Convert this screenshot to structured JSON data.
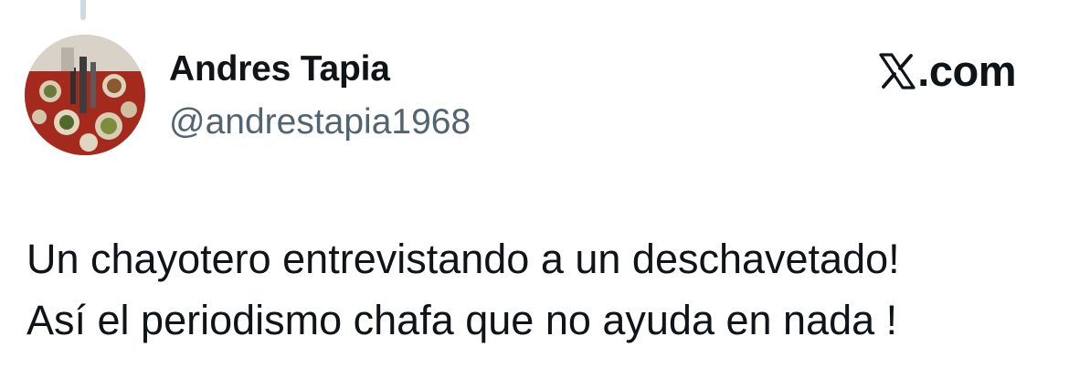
{
  "author": {
    "display_name": "Andres Tapia",
    "handle": "@andrestapia1968",
    "avatar_icon": "profile-photo-table-food"
  },
  "brand": {
    "icon": "x-logo-icon",
    "domain_text": ".com"
  },
  "tweet": {
    "lines": [
      "Un chayotero entrevistando a un deschavetado!",
      "Así el periodismo chafa que no ayuda en nada !"
    ]
  },
  "colors": {
    "text_primary": "#0f1419",
    "text_secondary": "#536471",
    "thread_line": "#cfd9de",
    "background": "#ffffff"
  }
}
